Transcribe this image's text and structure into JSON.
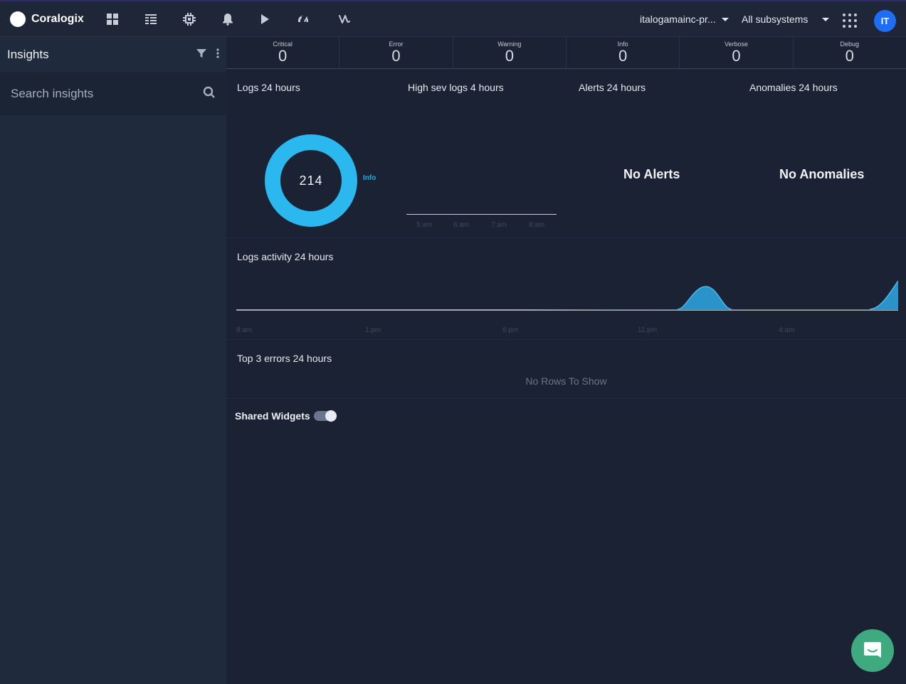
{
  "brand": {
    "name": "Coralogix"
  },
  "nav": {
    "icons": [
      "dashboard-icon",
      "logs-icon",
      "processor-icon",
      "alerts-bell-icon",
      "play-icon",
      "gauge-icon",
      "flow-icon"
    ]
  },
  "account": {
    "name": "italogamainc-pr...",
    "subsystem": "All subsystems"
  },
  "user": {
    "initials": "IT"
  },
  "sidebar": {
    "title": "Insights",
    "search_placeholder": "Search insights"
  },
  "severities": [
    {
      "label": "Critical",
      "value": "0"
    },
    {
      "label": "Error",
      "value": "0"
    },
    {
      "label": "Warning",
      "value": "0"
    },
    {
      "label": "Info",
      "value": "0"
    },
    {
      "label": "Verbose",
      "value": "0"
    },
    {
      "label": "Debug",
      "value": "0"
    }
  ],
  "widgets": {
    "logs": {
      "title": "Logs 24 hours",
      "total": "214",
      "legend": "Info",
      "color": "#2bb8ef"
    },
    "high_sev": {
      "title": "High sev logs 4 hours",
      "ticks": [
        "5:am",
        "6:am",
        "7:am",
        "8:am"
      ]
    },
    "alerts": {
      "title": "Alerts 24 hours",
      "empty": "No Alerts"
    },
    "anomalies": {
      "title": "Anomalies 24 hours",
      "empty": "No Anomalies"
    }
  },
  "activity": {
    "title": "Logs activity 24 hours",
    "ticks": [
      "8:am",
      "1:pm",
      "6:pm",
      "11:pm",
      "4:am"
    ],
    "fill_color": "#2a93c9"
  },
  "errors": {
    "title": "Top 3 errors 24 hours",
    "empty": "No Rows To Show"
  },
  "shared": {
    "label": "Shared Widgets",
    "enabled": true
  }
}
